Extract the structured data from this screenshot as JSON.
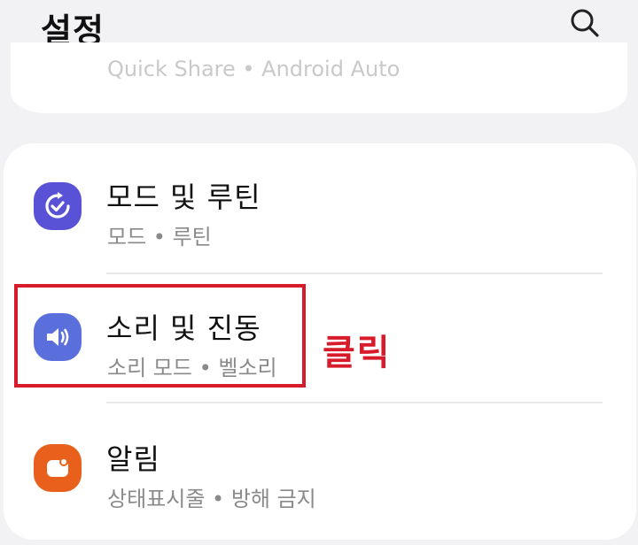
{
  "header": {
    "title": "설정",
    "search_icon": "search-icon"
  },
  "previous_card": {
    "subtitle": "Quick Share  •  Android Auto"
  },
  "items": [
    {
      "title": "모드 및 루틴",
      "subtitle": "모드  •  루틴",
      "icon": "modes-routines-icon",
      "icon_color": "#5a52d6"
    },
    {
      "title": "소리 및 진동",
      "subtitle": "소리 모드  •  벨소리",
      "icon": "speaker-icon",
      "icon_color": "#5b6fdc"
    },
    {
      "title": "알림",
      "subtitle": "상태표시줄  •  방해 금지",
      "icon": "notification-icon",
      "icon_color": "#e8601c"
    }
  ],
  "annotation": {
    "label": "클릭",
    "color": "#d81b2b"
  }
}
